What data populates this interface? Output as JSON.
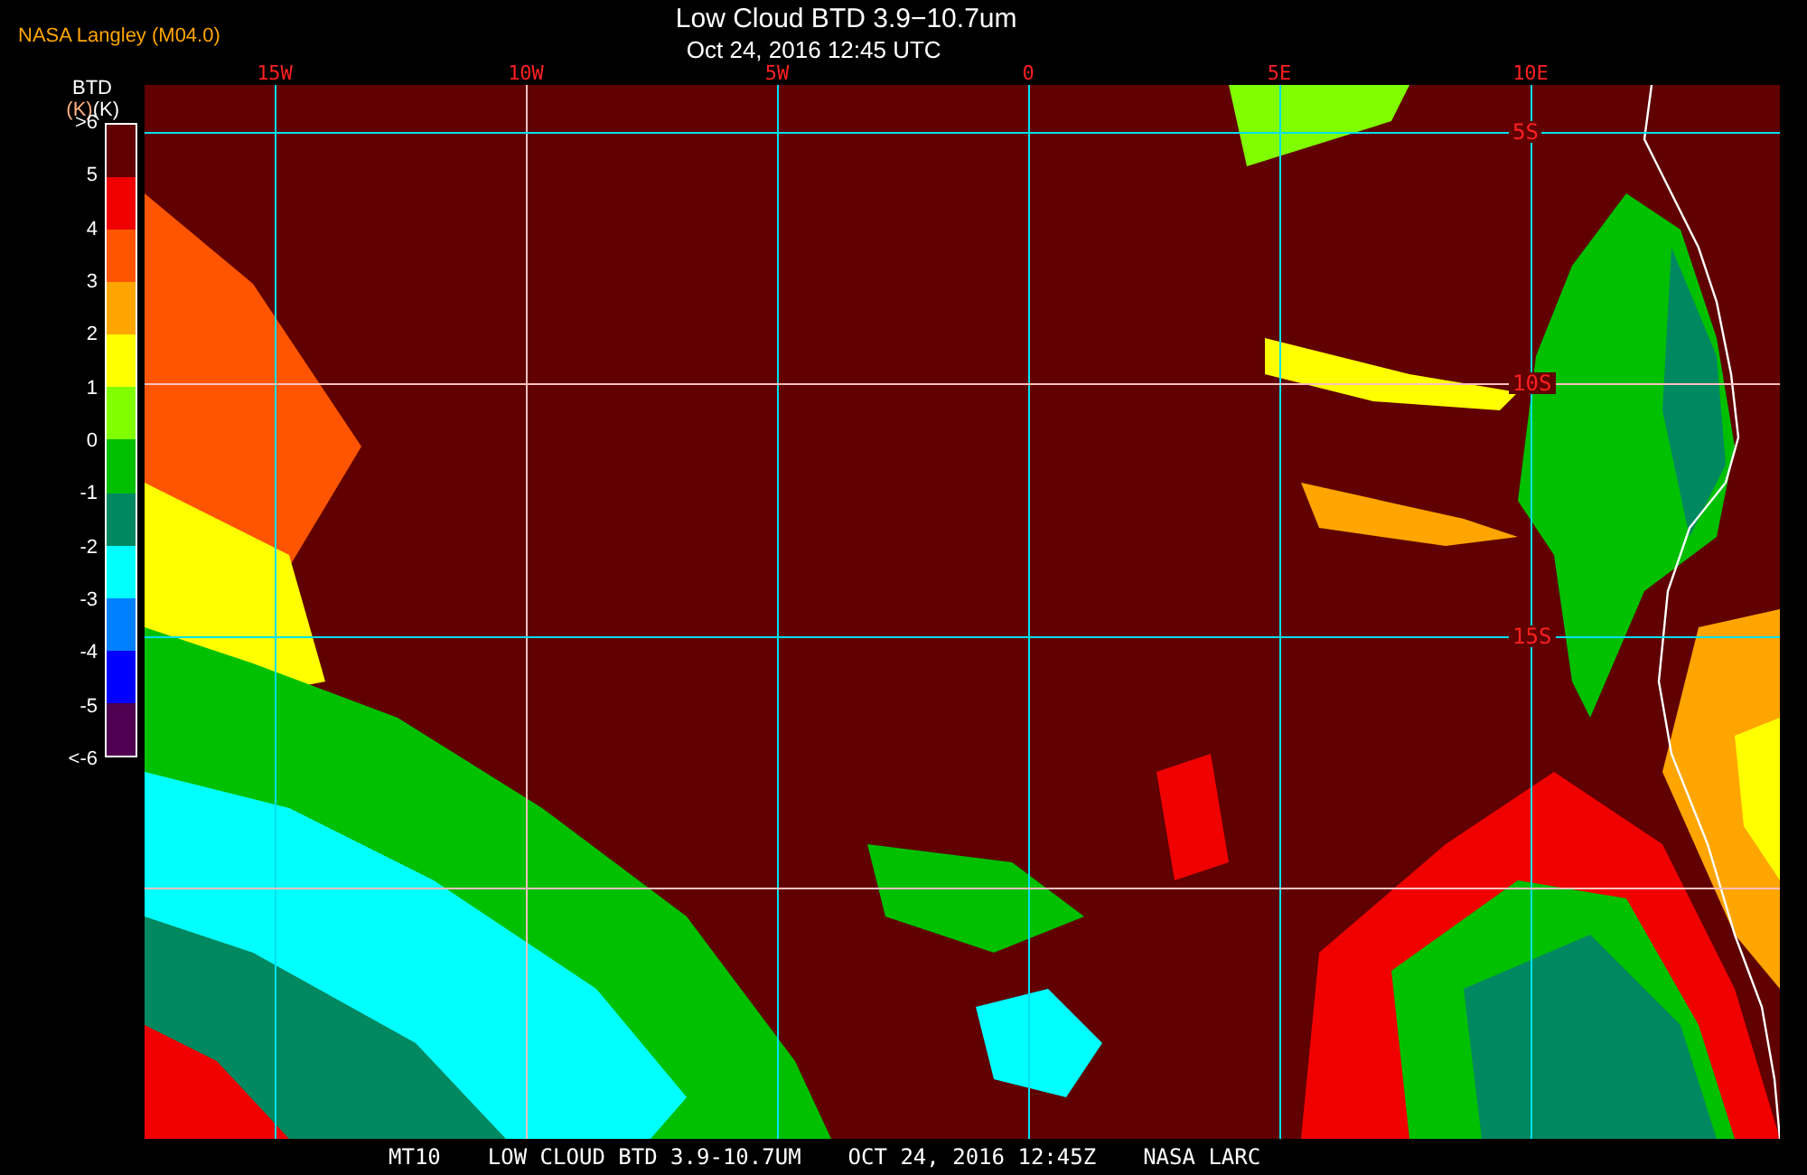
{
  "header": {
    "source": "NASA Langley (M04.0)",
    "title": "Low Cloud BTD 3.9−10.7um",
    "subtitle": "Oct 24, 2016 12:45 UTC"
  },
  "legend": {
    "title": "BTD",
    "units": [
      "(K)",
      "(K)"
    ],
    "labels": [
      ">6",
      "5",
      "4",
      "3",
      "2",
      "1",
      "0",
      "-1",
      "-2",
      "-3",
      "-4",
      "-5",
      "<-6"
    ],
    "bins": [
      {
        "color": "#600000"
      },
      {
        "color": "#f00000"
      },
      {
        "color": "#ff5500"
      },
      {
        "color": "#ffa500"
      },
      {
        "color": "#ffff00"
      },
      {
        "color": "#80ff00"
      },
      {
        "color": "#00c000"
      },
      {
        "color": "#008860"
      },
      {
        "color": "#00ffff"
      },
      {
        "color": "#0080ff"
      },
      {
        "color": "#0000ff"
      },
      {
        "color": "#500050"
      }
    ]
  },
  "map": {
    "longitude_labels": [
      "15W",
      "10W",
      "5W",
      "0",
      "5E",
      "10E"
    ],
    "latitude_labels": [
      "5S",
      "10S",
      "15S"
    ]
  },
  "footer": [
    "MT10",
    "LOW CLOUD BTD 3.9-10.7UM",
    "OCT 24, 2016 12:45Z",
    "NASA LARC"
  ]
}
